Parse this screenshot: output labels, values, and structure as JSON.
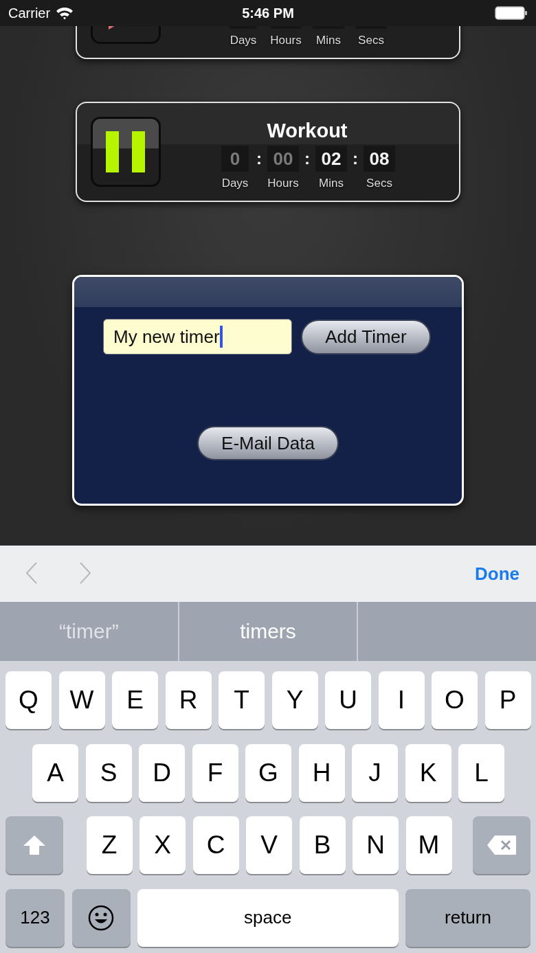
{
  "status_bar": {
    "carrier": "Carrier",
    "time": "5:46 PM"
  },
  "timers": [
    {
      "running": false,
      "units": [
        {
          "label": "Days"
        },
        {
          "label": "Hours"
        },
        {
          "label": "Mins"
        },
        {
          "label": "Secs"
        }
      ]
    },
    {
      "running": true,
      "title": "Workout",
      "units": [
        {
          "value": "0",
          "dimmed": true,
          "label": "Days"
        },
        {
          "separator": ":",
          "value": "00",
          "dimmed": true,
          "label": "Hours"
        },
        {
          "separator": ":",
          "value": "02",
          "dimmed": false,
          "label": "Mins"
        },
        {
          "separator": ":",
          "value": "08",
          "dimmed": false,
          "label": "Secs"
        }
      ]
    }
  ],
  "dialog": {
    "field": {
      "value": "My new timer",
      "focused": true
    },
    "add_button": "Add Timer",
    "email_button": "E-Mail Data"
  },
  "keyboard": {
    "toolbar": {
      "nav": [
        {
          "kind": "previous",
          "disabled": true
        },
        {
          "kind": "next",
          "disabled": true
        }
      ],
      "done": "Done"
    },
    "suggestions": [
      {
        "text": "“timer”",
        "quoted": true
      },
      {
        "text": "timers",
        "quoted": false
      }
    ],
    "rows": [
      {
        "keys": [
          {
            "kind": "letter",
            "label": "Q"
          },
          {
            "kind": "letter",
            "label": "W"
          },
          {
            "kind": "letter",
            "label": "E"
          },
          {
            "kind": "letter",
            "label": "R"
          },
          {
            "kind": "letter",
            "label": "T"
          },
          {
            "kind": "letter",
            "label": "Y"
          },
          {
            "kind": "letter",
            "label": "U"
          },
          {
            "kind": "letter",
            "label": "I"
          },
          {
            "kind": "letter",
            "label": "O"
          },
          {
            "kind": "letter",
            "label": "P"
          }
        ]
      },
      {
        "keys": [
          {
            "kind": "letter",
            "label": "A"
          },
          {
            "kind": "letter",
            "label": "S"
          },
          {
            "kind": "letter",
            "label": "D"
          },
          {
            "kind": "letter",
            "label": "F"
          },
          {
            "kind": "letter",
            "label": "G"
          },
          {
            "kind": "letter",
            "label": "H"
          },
          {
            "kind": "letter",
            "label": "J"
          },
          {
            "kind": "letter",
            "label": "K"
          },
          {
            "kind": "letter",
            "label": "L"
          }
        ]
      },
      {
        "keys": [
          {
            "kind": "shift"
          },
          {
            "kind": "letter",
            "label": "Z"
          },
          {
            "kind": "letter",
            "label": "X"
          },
          {
            "kind": "letter",
            "label": "C"
          },
          {
            "kind": "letter",
            "label": "V"
          },
          {
            "kind": "letter",
            "label": "B"
          },
          {
            "kind": "letter",
            "label": "N"
          },
          {
            "kind": "letter",
            "label": "M"
          },
          {
            "kind": "delete"
          }
        ]
      },
      {
        "keys": [
          {
            "kind": "numbers",
            "label": "123"
          },
          {
            "kind": "emoji"
          },
          {
            "kind": "space",
            "label": "space"
          },
          {
            "kind": "return",
            "label": "return"
          }
        ]
      }
    ]
  }
}
